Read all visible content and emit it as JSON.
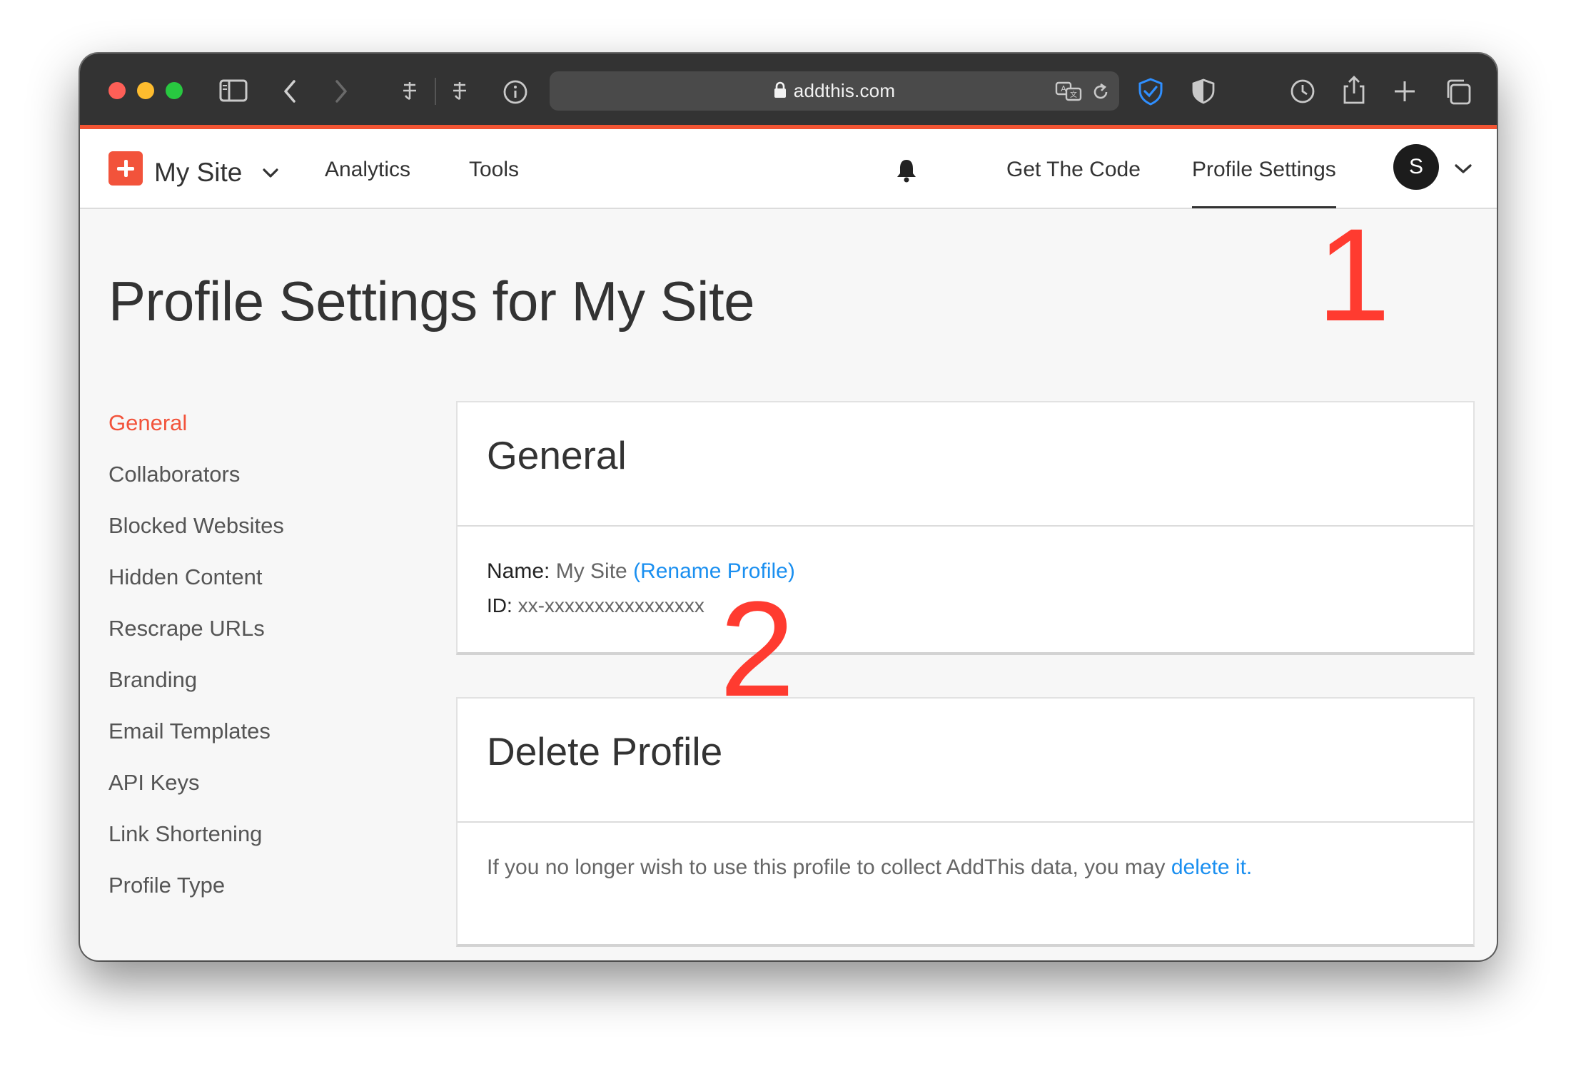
{
  "browser": {
    "url": "addthis.com",
    "lock_icon": "lock-icon"
  },
  "nav": {
    "site_name": "My Site",
    "links": [
      "Analytics",
      "Tools",
      "Get The Code",
      "Profile Settings"
    ],
    "active": "Profile Settings",
    "avatar_initial": "S"
  },
  "page": {
    "title": "Profile Settings for My Site"
  },
  "sidebar": {
    "items": [
      {
        "label": "General",
        "active": true
      },
      {
        "label": "Collaborators",
        "active": false
      },
      {
        "label": "Blocked Websites",
        "active": false
      },
      {
        "label": "Hidden Content",
        "active": false
      },
      {
        "label": "Rescrape URLs",
        "active": false
      },
      {
        "label": "Branding",
        "active": false
      },
      {
        "label": "Email Templates",
        "active": false
      },
      {
        "label": "API Keys",
        "active": false
      },
      {
        "label": "Link Shortening",
        "active": false
      },
      {
        "label": "Profile Type",
        "active": false
      }
    ]
  },
  "general_card": {
    "title": "General",
    "name_label": "Name:",
    "name_value": "My Site",
    "rename_link": "(Rename Profile)",
    "id_label": "ID:",
    "id_value": "xx-xxxxxxxxxxxxxxxx"
  },
  "delete_card": {
    "title": "Delete Profile",
    "text": "If you no longer wish to use this profile to collect AddThis data, you may",
    "link": "delete it."
  },
  "annotations": [
    "1",
    "2"
  ],
  "colors": {
    "accent": "#f2533b",
    "link": "#1a8ff0",
    "annotation": "#ff3b30",
    "toolbar": "#333333"
  }
}
